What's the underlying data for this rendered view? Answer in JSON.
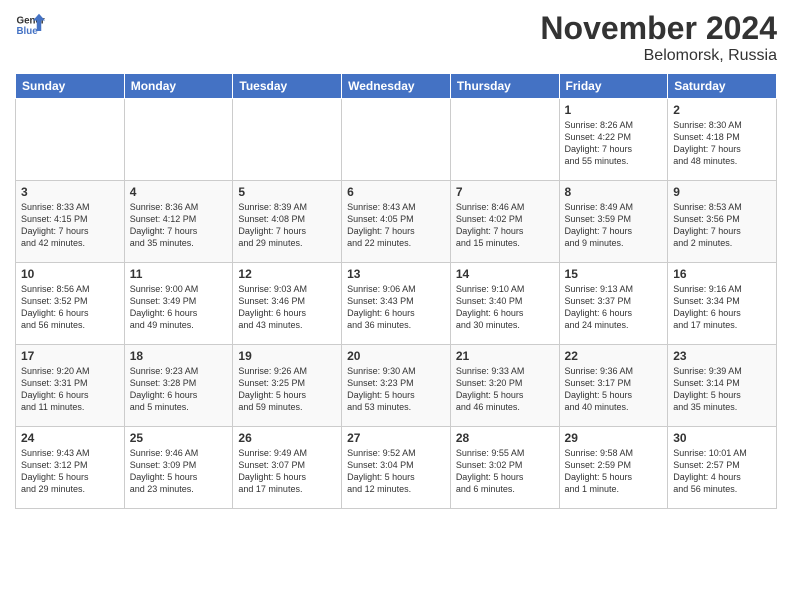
{
  "header": {
    "logo_general": "General",
    "logo_blue": "Blue",
    "month_year": "November 2024",
    "location": "Belomorsk, Russia"
  },
  "days_of_week": [
    "Sunday",
    "Monday",
    "Tuesday",
    "Wednesday",
    "Thursday",
    "Friday",
    "Saturday"
  ],
  "weeks": [
    {
      "days": [
        {
          "date": "",
          "info": ""
        },
        {
          "date": "",
          "info": ""
        },
        {
          "date": "",
          "info": ""
        },
        {
          "date": "",
          "info": ""
        },
        {
          "date": "",
          "info": ""
        },
        {
          "date": "1",
          "info": "Sunrise: 8:26 AM\nSunset: 4:22 PM\nDaylight: 7 hours\nand 55 minutes."
        },
        {
          "date": "2",
          "info": "Sunrise: 8:30 AM\nSunset: 4:18 PM\nDaylight: 7 hours\nand 48 minutes."
        }
      ]
    },
    {
      "days": [
        {
          "date": "3",
          "info": "Sunrise: 8:33 AM\nSunset: 4:15 PM\nDaylight: 7 hours\nand 42 minutes."
        },
        {
          "date": "4",
          "info": "Sunrise: 8:36 AM\nSunset: 4:12 PM\nDaylight: 7 hours\nand 35 minutes."
        },
        {
          "date": "5",
          "info": "Sunrise: 8:39 AM\nSunset: 4:08 PM\nDaylight: 7 hours\nand 29 minutes."
        },
        {
          "date": "6",
          "info": "Sunrise: 8:43 AM\nSunset: 4:05 PM\nDaylight: 7 hours\nand 22 minutes."
        },
        {
          "date": "7",
          "info": "Sunrise: 8:46 AM\nSunset: 4:02 PM\nDaylight: 7 hours\nand 15 minutes."
        },
        {
          "date": "8",
          "info": "Sunrise: 8:49 AM\nSunset: 3:59 PM\nDaylight: 7 hours\nand 9 minutes."
        },
        {
          "date": "9",
          "info": "Sunrise: 8:53 AM\nSunset: 3:56 PM\nDaylight: 7 hours\nand 2 minutes."
        }
      ]
    },
    {
      "days": [
        {
          "date": "10",
          "info": "Sunrise: 8:56 AM\nSunset: 3:52 PM\nDaylight: 6 hours\nand 56 minutes."
        },
        {
          "date": "11",
          "info": "Sunrise: 9:00 AM\nSunset: 3:49 PM\nDaylight: 6 hours\nand 49 minutes."
        },
        {
          "date": "12",
          "info": "Sunrise: 9:03 AM\nSunset: 3:46 PM\nDaylight: 6 hours\nand 43 minutes."
        },
        {
          "date": "13",
          "info": "Sunrise: 9:06 AM\nSunset: 3:43 PM\nDaylight: 6 hours\nand 36 minutes."
        },
        {
          "date": "14",
          "info": "Sunrise: 9:10 AM\nSunset: 3:40 PM\nDaylight: 6 hours\nand 30 minutes."
        },
        {
          "date": "15",
          "info": "Sunrise: 9:13 AM\nSunset: 3:37 PM\nDaylight: 6 hours\nand 24 minutes."
        },
        {
          "date": "16",
          "info": "Sunrise: 9:16 AM\nSunset: 3:34 PM\nDaylight: 6 hours\nand 17 minutes."
        }
      ]
    },
    {
      "days": [
        {
          "date": "17",
          "info": "Sunrise: 9:20 AM\nSunset: 3:31 PM\nDaylight: 6 hours\nand 11 minutes."
        },
        {
          "date": "18",
          "info": "Sunrise: 9:23 AM\nSunset: 3:28 PM\nDaylight: 6 hours\nand 5 minutes."
        },
        {
          "date": "19",
          "info": "Sunrise: 9:26 AM\nSunset: 3:25 PM\nDaylight: 5 hours\nand 59 minutes."
        },
        {
          "date": "20",
          "info": "Sunrise: 9:30 AM\nSunset: 3:23 PM\nDaylight: 5 hours\nand 53 minutes."
        },
        {
          "date": "21",
          "info": "Sunrise: 9:33 AM\nSunset: 3:20 PM\nDaylight: 5 hours\nand 46 minutes."
        },
        {
          "date": "22",
          "info": "Sunrise: 9:36 AM\nSunset: 3:17 PM\nDaylight: 5 hours\nand 40 minutes."
        },
        {
          "date": "23",
          "info": "Sunrise: 9:39 AM\nSunset: 3:14 PM\nDaylight: 5 hours\nand 35 minutes."
        }
      ]
    },
    {
      "days": [
        {
          "date": "24",
          "info": "Sunrise: 9:43 AM\nSunset: 3:12 PM\nDaylight: 5 hours\nand 29 minutes."
        },
        {
          "date": "25",
          "info": "Sunrise: 9:46 AM\nSunset: 3:09 PM\nDaylight: 5 hours\nand 23 minutes."
        },
        {
          "date": "26",
          "info": "Sunrise: 9:49 AM\nSunset: 3:07 PM\nDaylight: 5 hours\nand 17 minutes."
        },
        {
          "date": "27",
          "info": "Sunrise: 9:52 AM\nSunset: 3:04 PM\nDaylight: 5 hours\nand 12 minutes."
        },
        {
          "date": "28",
          "info": "Sunrise: 9:55 AM\nSunset: 3:02 PM\nDaylight: 5 hours\nand 6 minutes."
        },
        {
          "date": "29",
          "info": "Sunrise: 9:58 AM\nSunset: 2:59 PM\nDaylight: 5 hours\nand 1 minute."
        },
        {
          "date": "30",
          "info": "Sunrise: 10:01 AM\nSunset: 2:57 PM\nDaylight: 4 hours\nand 56 minutes."
        }
      ]
    }
  ]
}
